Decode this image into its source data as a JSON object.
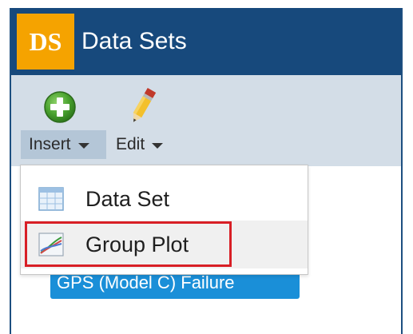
{
  "window": {
    "logo_text": "DS",
    "title": "Data Sets"
  },
  "toolbar": {
    "insert_icon": "plus-circle-icon",
    "edit_icon": "pencil-icon",
    "insert_label": "Insert",
    "edit_label": "Edit"
  },
  "content": {
    "dataset_chip_text": "GPS (Model C) Failure"
  },
  "insert_menu": {
    "items": [
      {
        "label": "Data Set",
        "icon": "data-set-icon"
      },
      {
        "label": "Group Plot",
        "icon": "group-plot-icon"
      }
    ]
  },
  "colors": {
    "titlebar": "#17497c",
    "logo_bg": "#f5a300",
    "ribbon_bg": "#d3dde7",
    "insert_active_bg": "#b4c6d7",
    "chip_bg": "#1a8fd8",
    "highlight": "#d81f26"
  }
}
